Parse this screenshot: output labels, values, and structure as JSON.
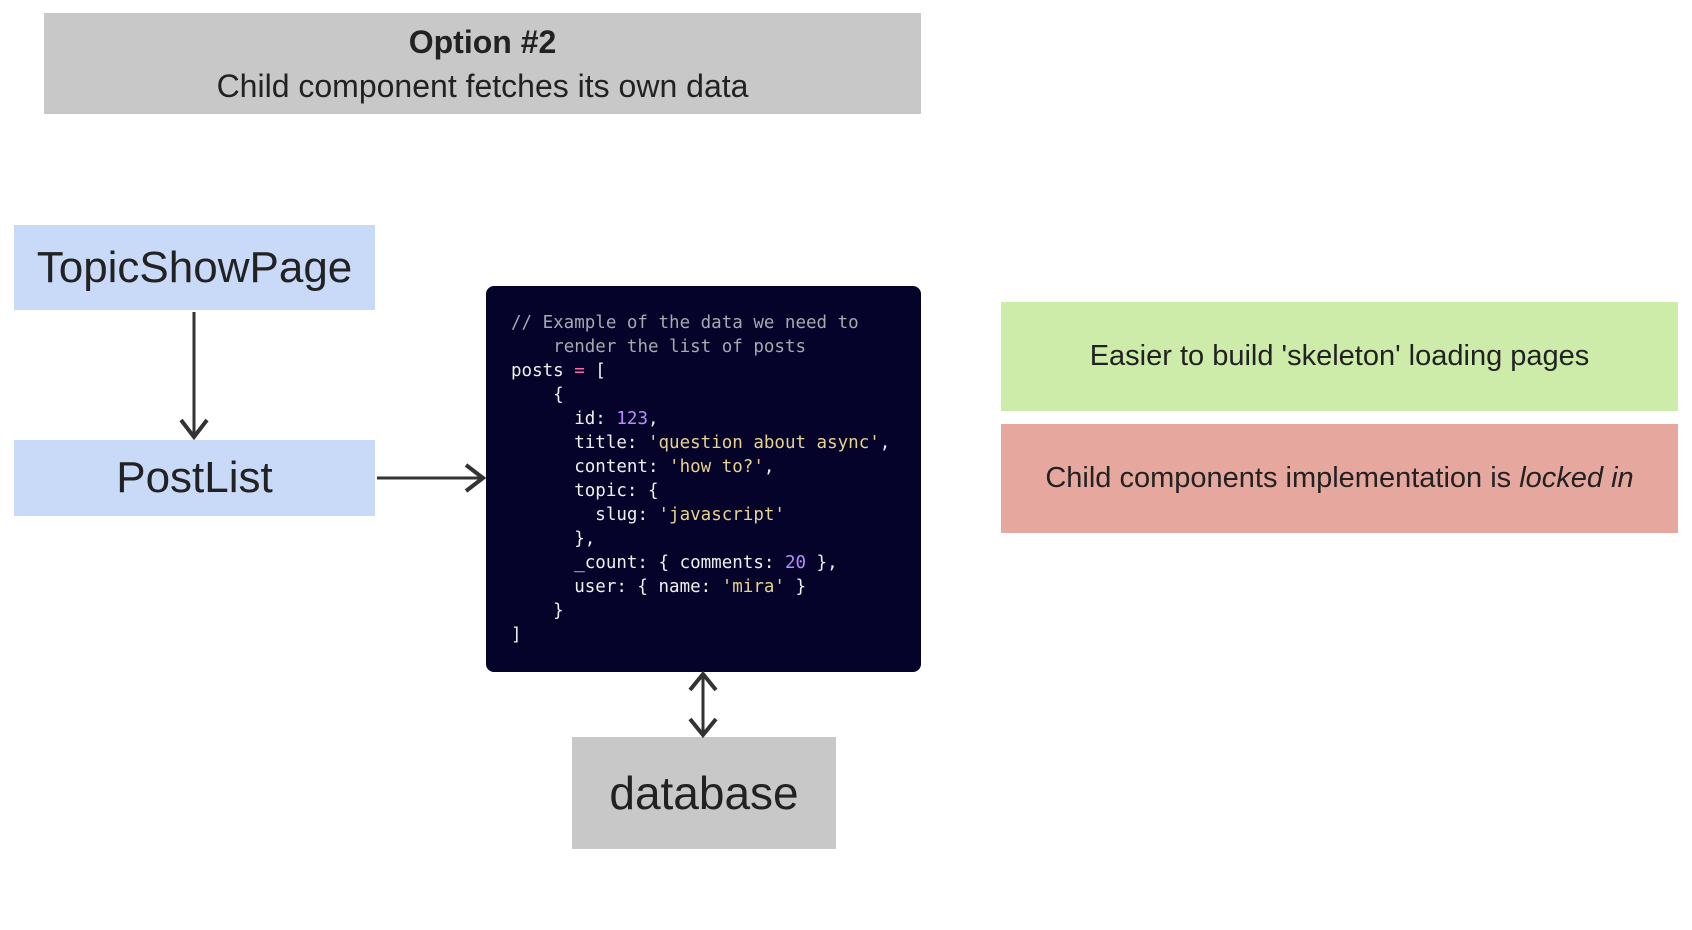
{
  "header": {
    "title": "Option #2",
    "subtitle": "Child component fetches its own data"
  },
  "nodes": {
    "topic_show_page": "TopicShowPage",
    "post_list": "PostList",
    "database": "database"
  },
  "code_lines": [
    {
      "indent": "",
      "parts": [
        {
          "t": "// Example of the data we need to",
          "c": "cm"
        }
      ]
    },
    {
      "indent": "    ",
      "parts": [
        {
          "t": "render the list of posts",
          "c": "cm"
        }
      ]
    },
    {
      "indent": "",
      "parts": [
        {
          "t": "posts ",
          "c": ""
        },
        {
          "t": "=",
          "c": "op"
        },
        {
          "t": " [",
          "c": ""
        }
      ]
    },
    {
      "indent": "    ",
      "parts": [
        {
          "t": "{",
          "c": ""
        }
      ]
    },
    {
      "indent": "      ",
      "parts": [
        {
          "t": "id: ",
          "c": ""
        },
        {
          "t": "123",
          "c": "num"
        },
        {
          "t": ",",
          "c": ""
        }
      ]
    },
    {
      "indent": "      ",
      "parts": [
        {
          "t": "title: ",
          "c": ""
        },
        {
          "t": "'question about async'",
          "c": "str"
        },
        {
          "t": ",",
          "c": ""
        }
      ]
    },
    {
      "indent": "      ",
      "parts": [
        {
          "t": "content: ",
          "c": ""
        },
        {
          "t": "'how to?'",
          "c": "str"
        },
        {
          "t": ",",
          "c": ""
        }
      ]
    },
    {
      "indent": "      ",
      "parts": [
        {
          "t": "topic: {",
          "c": ""
        }
      ]
    },
    {
      "indent": "        ",
      "parts": [
        {
          "t": "slug: ",
          "c": ""
        },
        {
          "t": "'javascript'",
          "c": "str"
        }
      ]
    },
    {
      "indent": "      ",
      "parts": [
        {
          "t": "},",
          "c": ""
        }
      ]
    },
    {
      "indent": "      ",
      "parts": [
        {
          "t": "_count: { comments: ",
          "c": ""
        },
        {
          "t": "20",
          "c": "num"
        },
        {
          "t": " },",
          "c": ""
        }
      ]
    },
    {
      "indent": "      ",
      "parts": [
        {
          "t": "user: { name: ",
          "c": ""
        },
        {
          "t": "'mira'",
          "c": "str"
        },
        {
          "t": " }",
          "c": ""
        }
      ]
    },
    {
      "indent": "    ",
      "parts": [
        {
          "t": "}",
          "c": ""
        }
      ]
    },
    {
      "indent": "",
      "parts": [
        {
          "t": "]",
          "c": ""
        }
      ]
    }
  ],
  "notes": {
    "pro": "Easier to build 'skeleton' loading pages",
    "con_prefix": "Child components implementation is ",
    "con_emphasis": "locked in"
  },
  "colors": {
    "component": "#c9daf8",
    "header": "#c8c8c8",
    "code_bg": "#05032a",
    "pro": "#cdeba9",
    "con": "#e6a89e"
  }
}
